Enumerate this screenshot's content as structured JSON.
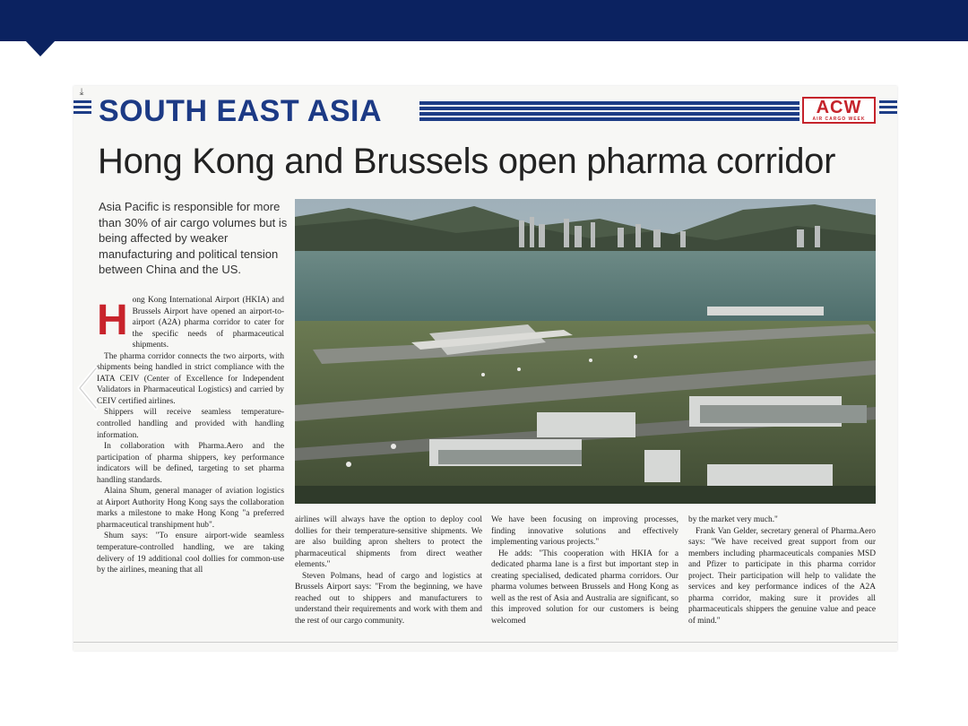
{
  "section_title": "SOUTH EAST ASIA",
  "brand": {
    "logo": "ACW",
    "tagline": "AIR CARGO WEEK"
  },
  "headline": "Hong Kong and Brussels open pharma corridor",
  "standfirst": "Asia Pacific is responsible for more than 30% of air cargo volumes but is being affected by weaker manufacturing and political tension between China and the US.",
  "photo_alt": "Aerial view of Hong Kong International Airport",
  "article": {
    "dropcap": "H",
    "p1": "ong Kong International Airport (HKIA) and Brussels Airport have opened an airport-to-airport (A2A) pharma corridor to cater for the specific needs of pharmaceutical shipments.",
    "p2": "The pharma corridor connects the two airports, with shipments being handled in strict compliance with the IATA CEIV (Center of Excellence for Independent Validators in Pharmaceutical Logistics) and carried by CEIV certified airlines.",
    "p3": "Shippers will receive seamless temperature-controlled handling and provided with handling information.",
    "p4": "In collaboration with Pharma.Aero and the participation of pharma shippers, key performance indicators will be defined, targeting to set pharma handling standards.",
    "p5": "Alaina Shum, general manager of aviation logistics at Airport Authority Hong Kong says the collaboration marks a milestone to make Hong Kong \"a preferred pharmaceutical transhipment hub\".",
    "p6": "Shum says: \"To ensure airport-wide seamless temperature-controlled handling, we are taking delivery of 19 additional cool dollies for common-use by the airlines, meaning that all",
    "p7": "airlines will always have the option to deploy cool dollies for their temperature-sensitive shipments. We are also building apron shelters to protect the pharmaceutical shipments from direct weather elements.\"",
    "p8": "Steven Polmans, head of cargo and logistics at Brussels Airport says: \"From the beginning, we have reached out to shippers and manufacturers to understand their requirements and work with them and the rest of our cargo community.",
    "p9": "We have been focusing on improving processes, finding innovative solutions and effectively implementing various projects.\"",
    "p10": "He adds: \"This cooperation with HKIA for a dedicated pharma lane is a first but important step in creating specialised, dedicated pharma corridors. Our pharma volumes between Brussels and Hong Kong as well as the rest of Asia and Australia are significant, so this improved solution for our customers is being welcomed",
    "p11": "by the market very much.\"",
    "p12": "Frank Van Gelder, secretary general of Pharma.Aero says: \"We have received great support from our members including pharmaceuticals companies MSD and Pfizer to participate in this pharma corridor project. Their participation will help to validate the services and key performance indices of the A2A pharma corridor, making sure it provides all pharmaceuticals shippers the genuine value and peace of mind.\""
  },
  "colors": {
    "header_bar": "#0b2260",
    "section_blue": "#1c3a85",
    "accent_red": "#c8232b"
  },
  "icons": {
    "corner": "download-icon",
    "nav": "chevron-left-icon"
  }
}
